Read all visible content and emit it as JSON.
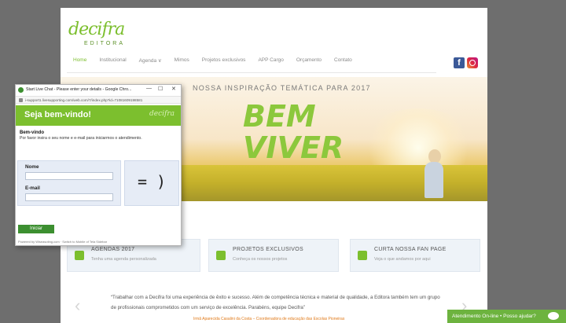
{
  "site": {
    "logo_text": "decifra",
    "logo_sub": "EDITORA",
    "nav": [
      "Home",
      "Institucional",
      "Agenda ∨",
      "Mimos",
      "Projetos exclusivos",
      "APP Cargo",
      "Orçamento",
      "Contato"
    ],
    "social": {
      "facebook": "f"
    },
    "hero": {
      "title": "NOSSA INSPIRAÇÃO TEMÁTICA PARA 2017",
      "big_line1": "BEM",
      "big_line2": "VIVER"
    },
    "cards": [
      {
        "title": "AGENDAS 2017",
        "subtitle": "Tenha uma agenda personalizada"
      },
      {
        "title": "PROJETOS EXCLUSIVOS",
        "subtitle": "Conheça os nossos projetos"
      },
      {
        "title": "CURTA NOSSA FAN PAGE",
        "subtitle": "Veja o que andamos por aqui"
      }
    ],
    "quote": "“Trabalhar com a Decifra foi uma experiência de êxito e sucesso. Além de competência técnica e material de qualidade, a Editora também tem um grupo de profissionais comprometidos com um serviço de excelência. Parabéns, equipe Decifra”",
    "quote_author": "Irmã Aparecida Casalini da Costa – Coordenadora de educação das Escolas Pioneiras"
  },
  "chat": {
    "window_title": "Start Live Chat - Please enter your details - Google Chro...",
    "controls": {
      "minimize": "—",
      "maximize": "☐",
      "close": "✕"
    },
    "url": "i-support1.livesupporting.com/web.com/7/index.php?id=71081609198581",
    "header_title": "Seja bem-vindo!",
    "header_logo": "decifra",
    "intro_heading": "Bem-vindo",
    "intro_text": "Por favor insira o seu nome e e-mail para iniciarmos o atendimento.",
    "name_label": "Nome",
    "email_label": "E-mail",
    "smiley": "= )",
    "start_button": "Iniciar",
    "powered_by": "Powered by Wiseasoting.com · Switch to Mobile of Tela Sidebar"
  },
  "online_bar": {
    "label": "Atendimento On-line  •  Posso ajudar?"
  }
}
